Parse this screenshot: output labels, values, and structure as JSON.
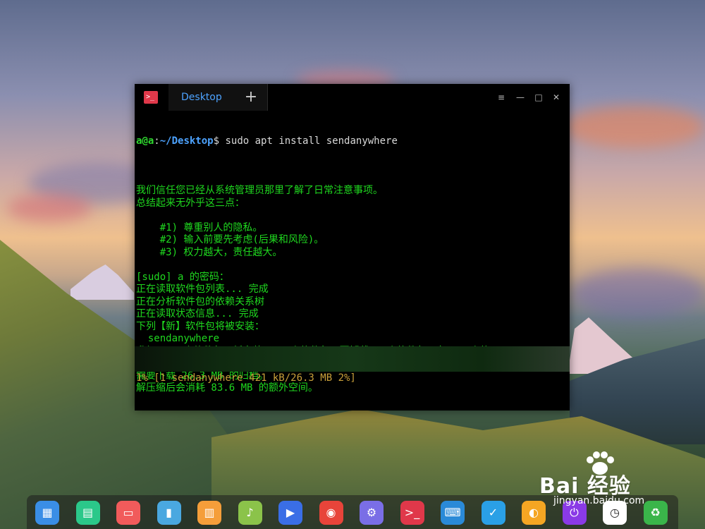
{
  "window": {
    "tab_label": "Desktop",
    "add_tab_symbol": "+",
    "menu_symbol": "≡",
    "minimize_symbol": "—",
    "maximize_symbol": "□",
    "close_symbol": "✕"
  },
  "terminal": {
    "prompt_user": "a@a",
    "prompt_colon": ":",
    "prompt_path": "~/Desktop",
    "prompt_dollar": "$",
    "command": " sudo apt install sendanywhere",
    "lines": [
      "",
      "我们信任您已经从系统管理员那里了解了日常注意事项。",
      "总结起来无外乎这三点：",
      "",
      "    #1) 尊重别人的隐私。",
      "    #2) 输入前要先考虑(后果和风险)。",
      "    #3) 权力越大，责任越大。",
      "",
      "[sudo] a 的密码：",
      "正在读取软件包列表... 完成",
      "正在分析软件包的依赖关系树",
      "正在读取状态信息... 完成",
      "下列【新】软件包将被安装：",
      "  sendanywhere",
      "升级了 0 个软件包，新安装了 1 个软件包，要卸载 0 个软件包，有 19 个软",
      "件包未被升级。",
      "需要下载 26.3 MB 的归档。",
      "解压缩后会消耗 83.6 MB 的额外空间。"
    ],
    "status_line": "1% [1 sendanywhere 421 kB/26.3 MB 2%]",
    "progress_percent": 1
  },
  "dock": {
    "items": [
      {
        "name": "launcher-icon",
        "glyph": "▦",
        "color": "#3a8ee6"
      },
      {
        "name": "file-manager-icon",
        "glyph": "▤",
        "color": "#2bc88a"
      },
      {
        "name": "screen-recorder-icon",
        "glyph": "▭",
        "color": "#f15b5b"
      },
      {
        "name": "archive-icon",
        "glyph": "▮",
        "color": "#4aa8e0"
      },
      {
        "name": "app-store-icon",
        "glyph": "▥",
        "color": "#f59e3a"
      },
      {
        "name": "music-icon",
        "glyph": "♪",
        "color": "#8bc34a"
      },
      {
        "name": "video-icon",
        "glyph": "▶",
        "color": "#3a6ee6"
      },
      {
        "name": "browser-icon",
        "glyph": "◉",
        "color": "#e8443a"
      },
      {
        "name": "settings-icon",
        "glyph": "⚙",
        "color": "#7a6ee6"
      },
      {
        "name": "terminal-icon",
        "glyph": ">_",
        "color": "#e0384a"
      },
      {
        "name": "input-method-icon",
        "glyph": "⌨",
        "color": "#2a8ad8"
      },
      {
        "name": "system-monitor-icon",
        "glyph": "✓",
        "color": "#2aa0e6"
      },
      {
        "name": "shortcut-icon",
        "glyph": "◐",
        "color": "#f5a623"
      },
      {
        "name": "power-icon",
        "glyph": "⏻",
        "color": "#8a3ae6"
      },
      {
        "name": "clock-icon",
        "glyph": "◷",
        "color": "#ffffff"
      },
      {
        "name": "trash-icon",
        "glyph": "♻",
        "color": "#3ab54a"
      }
    ]
  },
  "watermark": {
    "brand": "Bai  经验",
    "url": "jingyan.baidu.com"
  }
}
